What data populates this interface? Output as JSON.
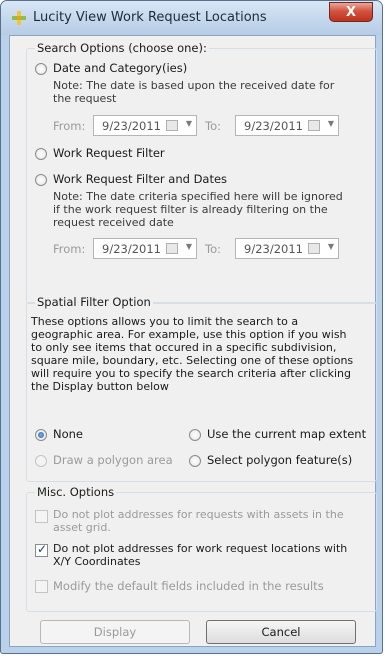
{
  "window": {
    "title": "Lucity View Work Request Locations",
    "icon": "plus-cross-icon",
    "close_glyph": "X"
  },
  "search_options": {
    "legend": "Search Options (choose one):",
    "date_category_label": "Date and Category(ies)",
    "date_category_note": "Note:  The date is based upon the received date for the request",
    "from_label": "From:",
    "to_label": "To:",
    "from_date_1": "9/23/2011",
    "to_date_1": "9/23/2011",
    "wr_filter_label": "Work Request Filter",
    "wr_filter_dates_label": "Work Request Filter and Dates",
    "wr_filter_dates_note": "Note:  The date criteria specified here will be ignored if the work request filter is already filtering on the request received date",
    "from_date_2": "9/23/2011",
    "to_date_2": "9/23/2011"
  },
  "spatial": {
    "legend": "Spatial Filter Option",
    "description": "These options allows you to limit the search to a geographic area.  For example, use this option if you wish to only see items that occured in a specific subdivision, square mile, boundary, etc.  Selecting one of these options will require you to specify the search criteria after clicking the Display button below",
    "none_label": "None",
    "map_extent_label": "Use the current map extent",
    "polygon_area_label": "Draw a polygon area",
    "polygon_feature_label": "Select polygon feature(s)"
  },
  "misc": {
    "legend": "Misc. Options",
    "opt1_label": "Do not plot addresses for requests with assets in the asset grid.",
    "opt2_label": "Do not plot addresses for work request locations with X/Y Coordinates",
    "opt3_label": "Modify the default fields included in the results"
  },
  "buttons": {
    "display": "Display",
    "cancel": "Cancel"
  }
}
